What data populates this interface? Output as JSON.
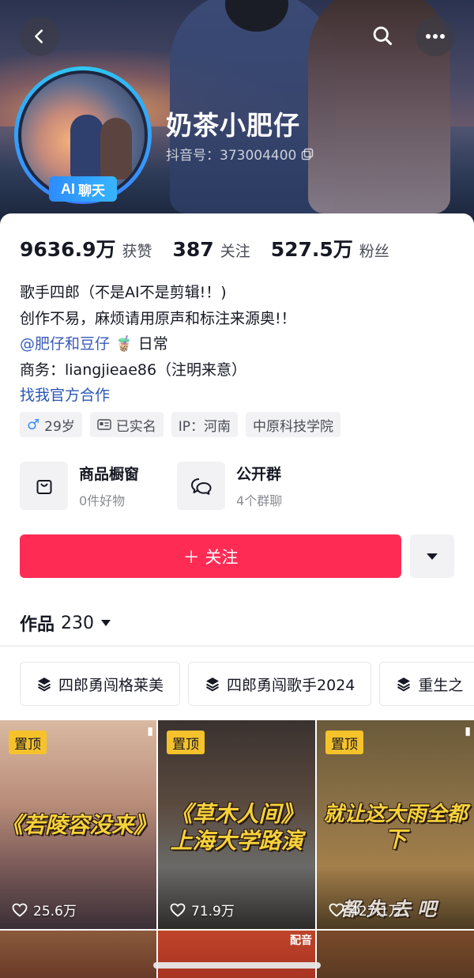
{
  "header": {
    "nickname": "奶茶小肥仔",
    "douyin_id": "抖音号：373004400",
    "ai_badge_ai": "AI",
    "ai_badge_text": "聊天"
  },
  "stats": [
    {
      "value": "9636.9万",
      "label": "获赞"
    },
    {
      "value": "387",
      "label": "关注"
    },
    {
      "value": "527.5万",
      "label": "粉丝"
    }
  ],
  "bio": {
    "line1": "歌手四郎（不是AI不是剪辑!！)",
    "line2": "创作不易，麻烦请用原声和标注来源奥!！",
    "mention": "@肥仔和豆仔",
    "mention_emoji": "🧋",
    "mention_suffix": "日常",
    "line4": "商务：liangjieae86（注明来意）",
    "official_link": "找我官方合作"
  },
  "tags": {
    "age": "29岁",
    "verified": "已实名",
    "ip": "IP：河南",
    "school": "中原科技学院"
  },
  "shortcuts": [
    {
      "title": "商品橱窗",
      "sub": "0件好物",
      "icon": "bag-icon"
    },
    {
      "title": "公开群",
      "sub": "4个群聊",
      "icon": "chat-bubbles-icon"
    }
  ],
  "follow_button": "＋ 关注",
  "works": {
    "label": "作品",
    "count": "230"
  },
  "collections": [
    "四郎勇闯格莱美",
    "四郎勇闯歌手2024",
    "重生之"
  ],
  "videos": [
    {
      "pinned": "置顶",
      "caption": "《若陵容没来》",
      "likes": "25.6万"
    },
    {
      "pinned": "置顶",
      "caption_line1": "《草木人间》",
      "caption_line2": "上海大学路演",
      "likes": "71.9万"
    },
    {
      "pinned": "置顶",
      "caption_line1": "就让这大雨全都",
      "caption_line2": "下",
      "likes": "427.1万",
      "bottom_text": "都 失 去 吧"
    }
  ],
  "row2_mark": "配音",
  "colors": {
    "accent": "#fe2c55",
    "link": "#2b57b6",
    "pin": "#f6c22b",
    "ai_badge": "#2d8cff"
  }
}
